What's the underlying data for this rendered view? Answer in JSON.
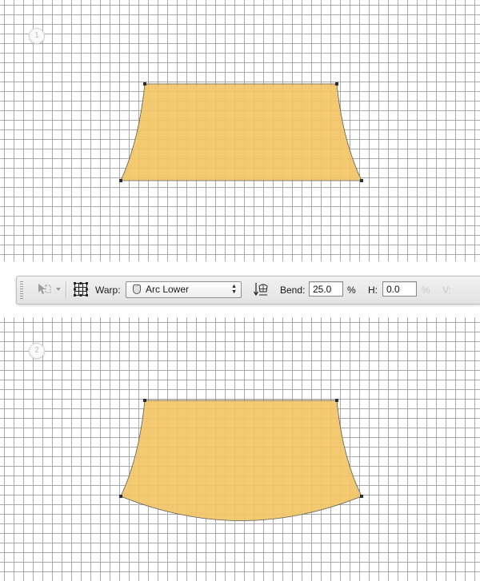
{
  "panels": [
    {
      "step_label": "1",
      "warp": "none"
    },
    {
      "step_label": "2",
      "warp": "arc-lower"
    }
  ],
  "shape": {
    "fill_color": "#F2C462",
    "anchor_color": "#2b2b3b"
  },
  "toolbar": {
    "warp_label": "Warp:",
    "warp_value": "Arc Lower",
    "bend_label": "Bend:",
    "bend_value": "25.0",
    "bend_unit": "%",
    "h_label": "H:",
    "h_value": "0.0",
    "h_unit": "%",
    "v_label": "V:"
  },
  "icons": {
    "transform_tool": "transform-arrow-icon",
    "warp_grid": "warp-grid-icon",
    "arc_lower": "arc-lower-shape-icon",
    "orientation": "change-warp-orientation-icon"
  }
}
